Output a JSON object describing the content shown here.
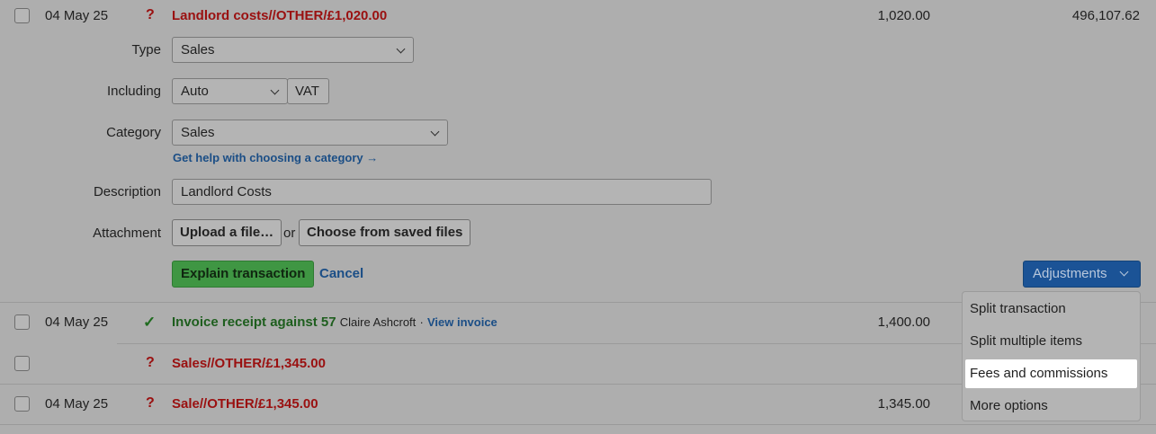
{
  "rows": [
    {
      "date": "04 May 25",
      "status": "?",
      "description": "Landlord costs//OTHER/£1,020.00",
      "amount": "1,020.00",
      "balance": "496,107.62"
    },
    {
      "date": "04 May 25",
      "status": "✓",
      "description": "Invoice receipt against 57",
      "contact": "Claire Ashcroft",
      "separator": "·",
      "link": "View invoice",
      "amount": "1,400.00"
    },
    {
      "date": "",
      "status": "?",
      "description": "Sales//OTHER/£1,345.00"
    },
    {
      "date": "04 May 25",
      "status": "?",
      "description": "Sale//OTHER/£1,345.00",
      "amount": "1,345.00"
    }
  ],
  "form": {
    "type_label": "Type",
    "type_value": "Sales",
    "including_label": "Including",
    "including_value": "Auto",
    "vat_label": "VAT",
    "category_label": "Category",
    "category_value": "Sales",
    "category_help": "Get help with choosing a category →",
    "description_label": "Description",
    "description_value": "Landlord Costs",
    "attachment_label": "Attachment",
    "upload_label": "Upload a file…",
    "or_text": "or",
    "choose_label": "Choose from saved files",
    "explain_label": "Explain transaction",
    "cancel_label": "Cancel"
  },
  "adjustments": {
    "button_label": "Adjustments",
    "items": [
      "Split transaction",
      "Split multiple items",
      "Fees and commissions",
      "More options"
    ],
    "highlighted": "Fees and commissions"
  },
  "colors": {
    "overlay": "#aeaeae",
    "unexplained_red": "#9a1010",
    "explained_green": "#1e5e1e",
    "link_blue": "#1b4e86",
    "primary_green": "#3f9643",
    "adjust_blue": "#1b5396"
  }
}
